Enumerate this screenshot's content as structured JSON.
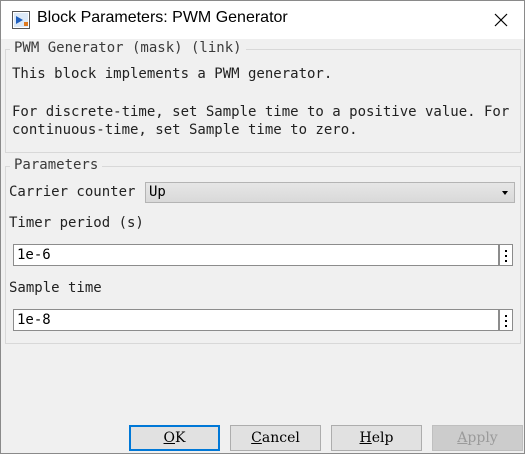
{
  "window": {
    "title": "Block Parameters: PWM Generator",
    "close_icon": "close-icon",
    "app_icon": "simulink-block-icon"
  },
  "mask_group": {
    "legend": "PWM Generator (mask) (link)",
    "description_line1": "This block implements a PWM generator.",
    "description_line2": "For discrete-time, set Sample time to a positive value. For",
    "description_line3": "continuous-time, set Sample time to zero."
  },
  "parameters_group": {
    "legend": "Parameters",
    "carrier_counter": {
      "label": "Carrier counter",
      "value": "Up"
    },
    "timer_period": {
      "label": "Timer period (s)",
      "value": "1e-6"
    },
    "sample_time": {
      "label": "Sample time",
      "value": "1e-8"
    }
  },
  "buttons": {
    "ok": {
      "first": "O",
      "rest": "K"
    },
    "cancel": {
      "first": "C",
      "rest": "ancel"
    },
    "help": {
      "first": "H",
      "rest": "elp"
    },
    "apply": {
      "first": "A",
      "rest": "pply",
      "disabled": true
    }
  },
  "colors": {
    "focus_border": "#0078d7",
    "dialog_bg": "#f0f0f0"
  }
}
